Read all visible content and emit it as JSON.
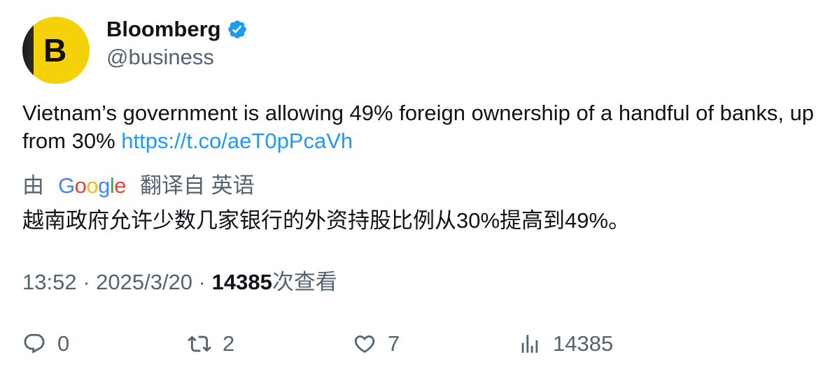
{
  "author": {
    "display_name": "Bloomberg",
    "handle": "@business",
    "avatar_letter": "B",
    "verified": true
  },
  "tweet": {
    "text": "Vietnam’s government is allowing 49% foreign ownership of a handful of banks, up from 30% ",
    "link": "https://t.co/aeT0pPcaVh"
  },
  "translation": {
    "prefix": "由",
    "brand_g1": "G",
    "brand_o1": "o",
    "brand_o2": "o",
    "brand_g2": "g",
    "brand_l": "l",
    "brand_e": "e",
    "suffix": "翻译自 英语",
    "text": "越南政府允许少数几家银行的外资持股比例从30%提高到49%。"
  },
  "meta": {
    "time": "13:52",
    "separator": " · ",
    "date": "2025/3/20",
    "views_count": "14385",
    "views_label": "次查看"
  },
  "actions": {
    "replies": "0",
    "retweets": "2",
    "likes": "7",
    "views": "14385"
  },
  "colors": {
    "link": "#1d9bf0",
    "secondary_text": "#536471",
    "avatar_bg": "#f5d10a",
    "verified_badge": "#1d9bf0"
  }
}
